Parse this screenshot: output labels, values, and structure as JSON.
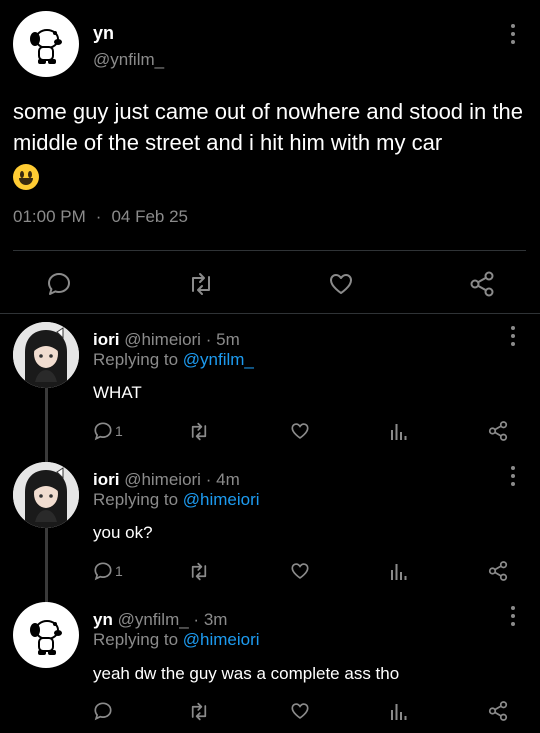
{
  "main_tweet": {
    "display_name": "yn",
    "handle": "@ynfilm_",
    "text": "some guy just came out of nowhere and stood in the middle of the street and i hit him with my car",
    "emoji": "grinning-face",
    "time": "01:00 PM",
    "separator": "·",
    "date": "04 Feb 25",
    "actions": [
      "reply-icon",
      "retweet-icon",
      "like-icon",
      "share-icon"
    ]
  },
  "replies": [
    {
      "display_name": "iori",
      "handle": "@himeiori",
      "dot": "·",
      "age": "5m",
      "replying_prefix": "Replying to ",
      "replying_to": "@ynfilm_",
      "text": "WHAT",
      "reply_count": "1",
      "avatar": "anime-girl-avatar"
    },
    {
      "display_name": "iori",
      "handle": "@himeiori",
      "dot": "·",
      "age": "4m",
      "replying_prefix": "Replying to ",
      "replying_to": "@himeiori",
      "text": "you ok?",
      "reply_count": "1",
      "avatar": "anime-girl-avatar"
    },
    {
      "display_name": "yn",
      "handle": "@ynfilm_",
      "dot": "·",
      "age": "3m",
      "replying_prefix": "Replying to ",
      "replying_to": "@himeiori",
      "text": "yeah dw the guy was a complete ass tho",
      "reply_count": "",
      "avatar": "snoopy-avatar"
    }
  ],
  "colors": {
    "background": "#000000",
    "text": "#ffffff",
    "muted": "#8b8b8b",
    "link": "#1d9bf0",
    "divider": "#2f3336"
  }
}
